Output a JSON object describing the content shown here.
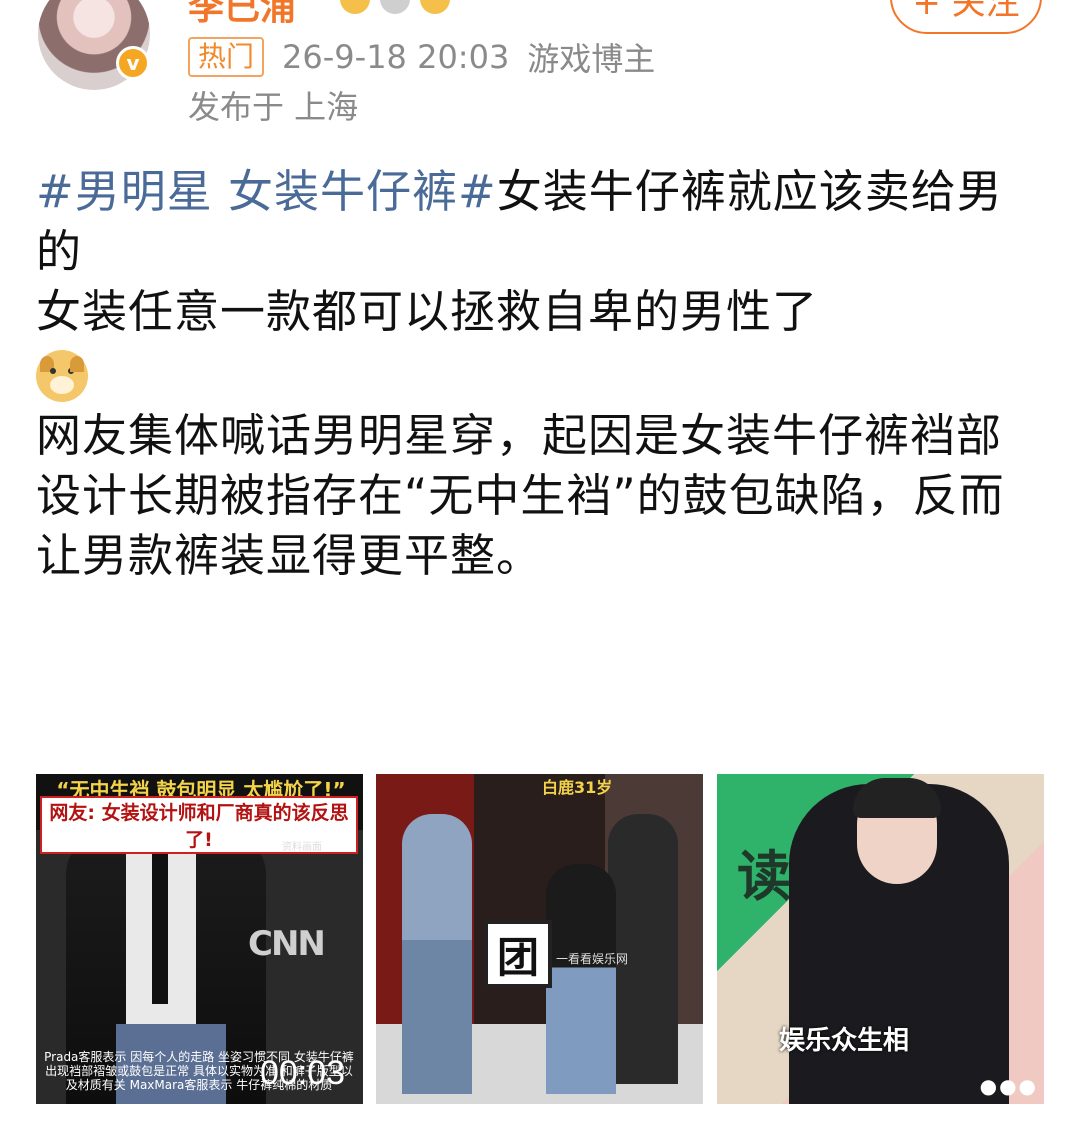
{
  "user": {
    "name": "李已浦",
    "follow_label": "+ 关注",
    "verified_mark": "v"
  },
  "meta": {
    "hot_tag": "热门",
    "timestamp": "26-9-18 20:03",
    "role": "游戏博主",
    "location": "发布于 上海"
  },
  "post": {
    "hashtag": "#男明星 女装牛仔裤#",
    "line1_rest": "女装牛仔裤就应该卖给男的",
    "line2": "女装任意一款都可以拯救自卑的男性了",
    "emoji": "doge-emoji",
    "paragraph": "网友集体喊话男明星穿，起因是女装牛仔裤裆部设计长期被指存在“无中生裆”的鼓包缺陷，反而让男款裤装显得更平整。"
  },
  "images": {
    "img1": {
      "title1": "“无中生裆 鼓包明显 太尴尬了!”",
      "title2": "网友: 女装设计师和厂商真的该反思了!",
      "source": "资料画面",
      "logo": "CNN",
      "caption": "Prada客服表示 因每个人的走路 坐姿习惯不同 女装牛仔裤出现裆部褶皱或鼓包是正常 具体以实物为准 和裤子版型以及材质有关 MaxMara客服表示 牛仔裤纯棉的材质",
      "video_time": "00:03"
    },
    "img2": {
      "sticker": "白鹿31岁",
      "sign": "团",
      "watermark": "一看看娱乐网"
    },
    "img3": {
      "watermark": "娱乐众生相",
      "big_text": "读书商"
    }
  }
}
